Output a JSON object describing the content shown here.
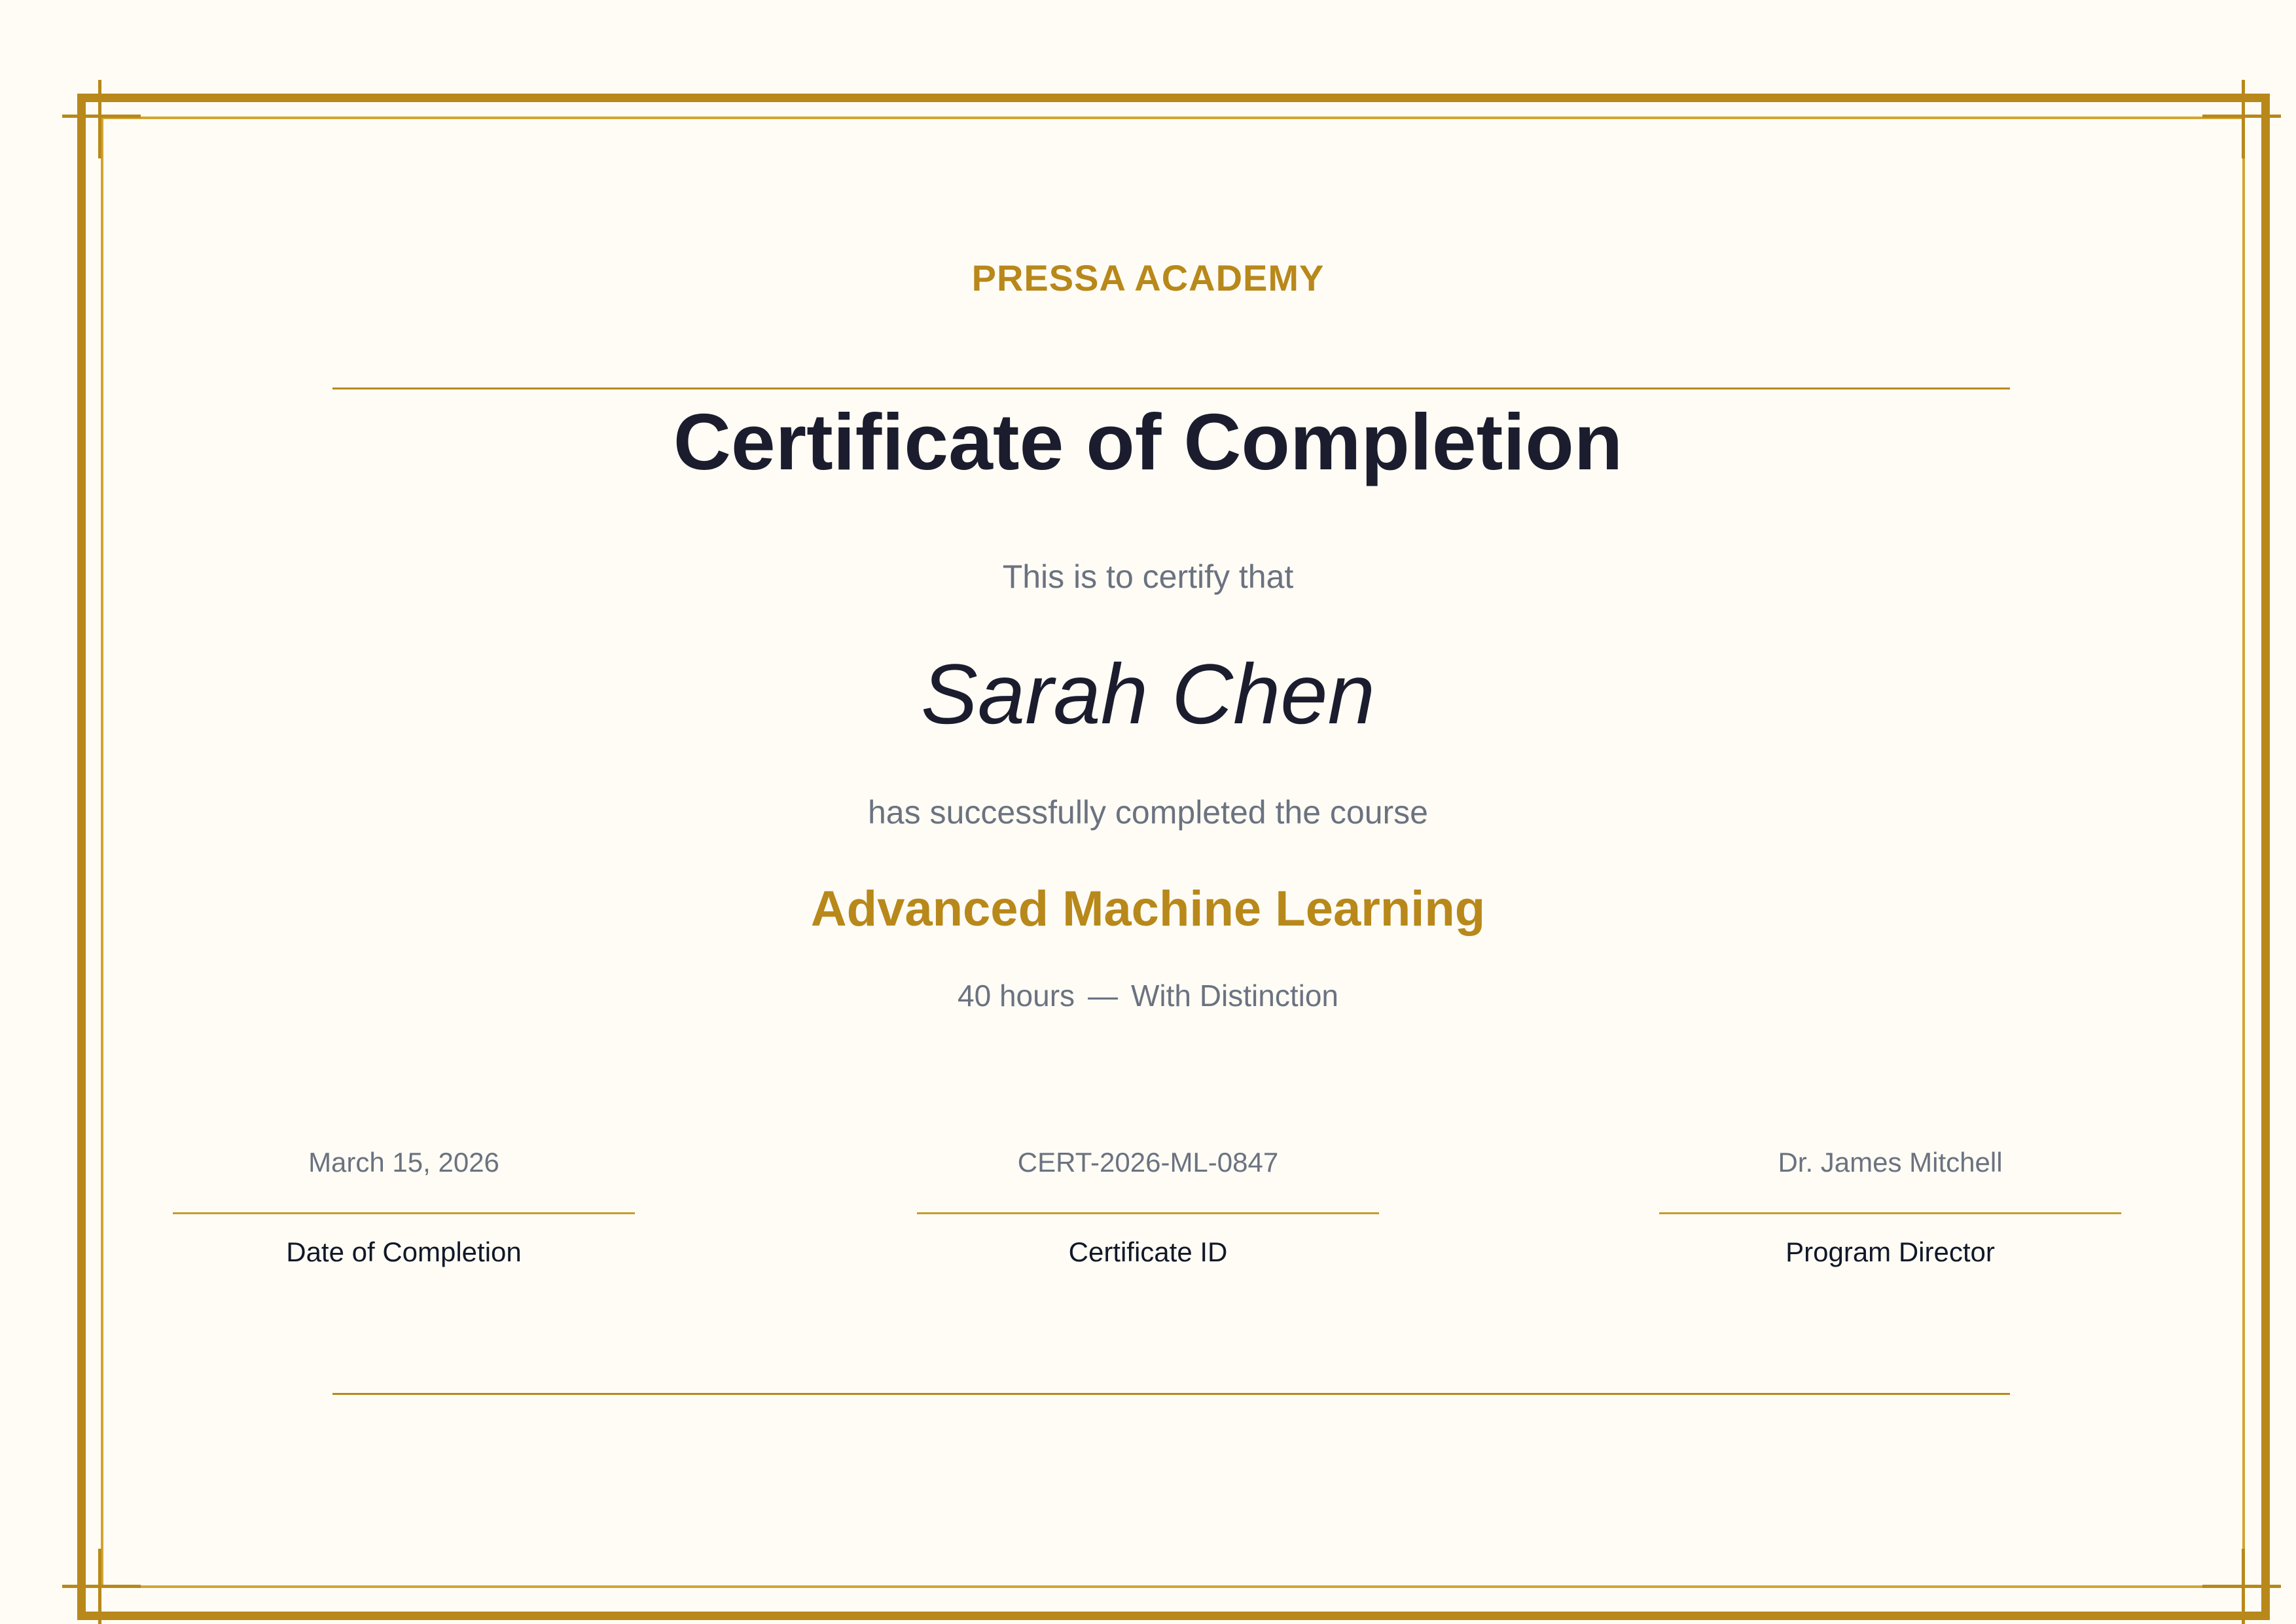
{
  "certificate": {
    "academy": "PRESSA ACADEMY",
    "title": "Certificate of Completion",
    "intro": "This is to certify that",
    "recipient": "Sarah Chen",
    "completed_text": "has successfully completed the course",
    "course": "Advanced Machine Learning",
    "hours": "40 hours",
    "separator": "—",
    "honor": "With Distinction"
  },
  "footer": {
    "date": {
      "value": "March 15, 2026",
      "label": "Date of Completion"
    },
    "cert_id": {
      "value": "CERT-2026-ML-0847",
      "label": "Certificate ID"
    },
    "director": {
      "value": "Dr. James Mitchell",
      "label": "Program Director"
    }
  },
  "colors": {
    "gold": "#b8881a",
    "navy": "#1b1d2e",
    "gray": "#6b7280",
    "background": "#fefcf5"
  }
}
